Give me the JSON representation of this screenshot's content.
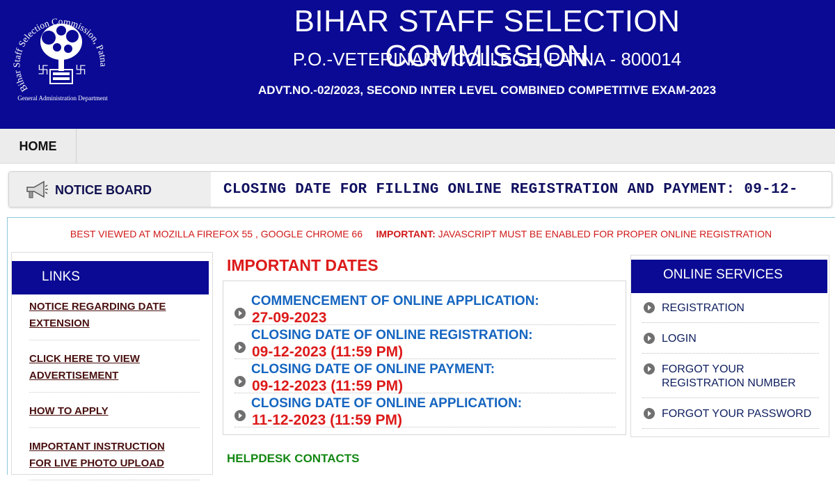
{
  "header": {
    "title": "BIHAR STAFF SELECTION COMMISSION",
    "address": "P.O.-VETERINARY COLLEGE, PATNA - 800014",
    "advt": "ADVT.NO.-02/2023, SECOND INTER LEVEL COMBINED COMPETITIVE EXAM-2023",
    "logo": {
      "ring_text_left": "Bihar Staff Selection Commission, Patna",
      "bottom_text": "General Administration Department",
      "icon": "tree-emblem-icon"
    }
  },
  "nav": {
    "home": "HOME"
  },
  "notice_board": {
    "label": "NOTICE BOARD",
    "icon": "megaphone-icon",
    "marquee": "CLOSING DATE FOR FILLING ONLINE REGISTRATION AND PAYMENT: 09-12-"
  },
  "browser_note": {
    "text": "BEST VIEWED AT MOZILLA FIREFOX 55 , GOOGLE CHROME 66",
    "important_label": "IMPORTANT:",
    "important_text": "JAVASCRIPT MUST BE ENABLED FOR PROPER ONLINE REGISTRATION"
  },
  "links": {
    "title": "LINKS",
    "items": [
      {
        "line1": "NOTICE REGARDING DATE",
        "line2": "EXTENSION"
      },
      {
        "line1": "CLICK HERE TO VIEW",
        "line2": "ADVERTISEMENT"
      },
      {
        "line1": "HOW TO APPLY",
        "line2": ""
      },
      {
        "line1": "IMPORTANT INSTRUCTION",
        "line2": "FOR LIVE PHOTO UPLOAD"
      }
    ]
  },
  "important_dates": {
    "title": "IMPORTANT DATES",
    "items": [
      {
        "label": "COMMENCEMENT OF ONLINE APPLICATION:",
        "value": "27-09-2023"
      },
      {
        "label": "CLOSING DATE OF ONLINE REGISTRATION:",
        "value": "09-12-2023 (11:59 PM)"
      },
      {
        "label": "CLOSING DATE OF ONLINE PAYMENT:",
        "value": "09-12-2023 (11:59 PM)"
      },
      {
        "label": "CLOSING DATE OF ONLINE APPLICATION:",
        "value": "11-12-2023 (11:59 PM)"
      }
    ]
  },
  "helpdesk": {
    "title": "HELPDESK CONTACTS"
  },
  "online_services": {
    "title": "ONLINE SERVICES",
    "items": [
      {
        "line1": "REGISTRATION",
        "line2": ""
      },
      {
        "line1": "LOGIN",
        "line2": ""
      },
      {
        "line1": "FORGOT YOUR",
        "line2": "REGISTRATION NUMBER"
      },
      {
        "line1": "FORGOT YOUR PASSWORD",
        "line2": ""
      }
    ]
  },
  "colors": {
    "brand_blue": "#0a0a94",
    "accent_red": "#dd1a1a",
    "date_label_blue": "#1565c0",
    "helpdesk_green": "#138813"
  }
}
